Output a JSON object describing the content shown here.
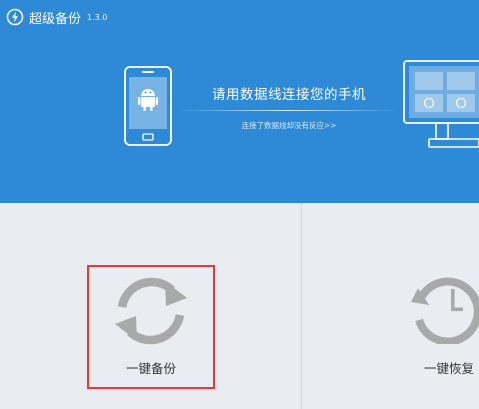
{
  "app": {
    "name": "超级备份",
    "version": "1.3.0"
  },
  "connect": {
    "title": "请用数据线连接您的手机",
    "help_link": "连接了数据线却没有反应>>"
  },
  "actions": {
    "backup_label": "一键备份",
    "restore_label": "一键恢复"
  },
  "colors": {
    "header_bg": "#2e8ad6",
    "panel_bg": "#e9ecf0",
    "icon_gray": "#a9a9a9",
    "highlight": "#e53935"
  },
  "icons": {
    "logo": "power-icon",
    "phone": "android-phone-icon",
    "monitor": "monitor-icon",
    "backup": "sync-arrows-icon",
    "restore": "clock-icon"
  }
}
